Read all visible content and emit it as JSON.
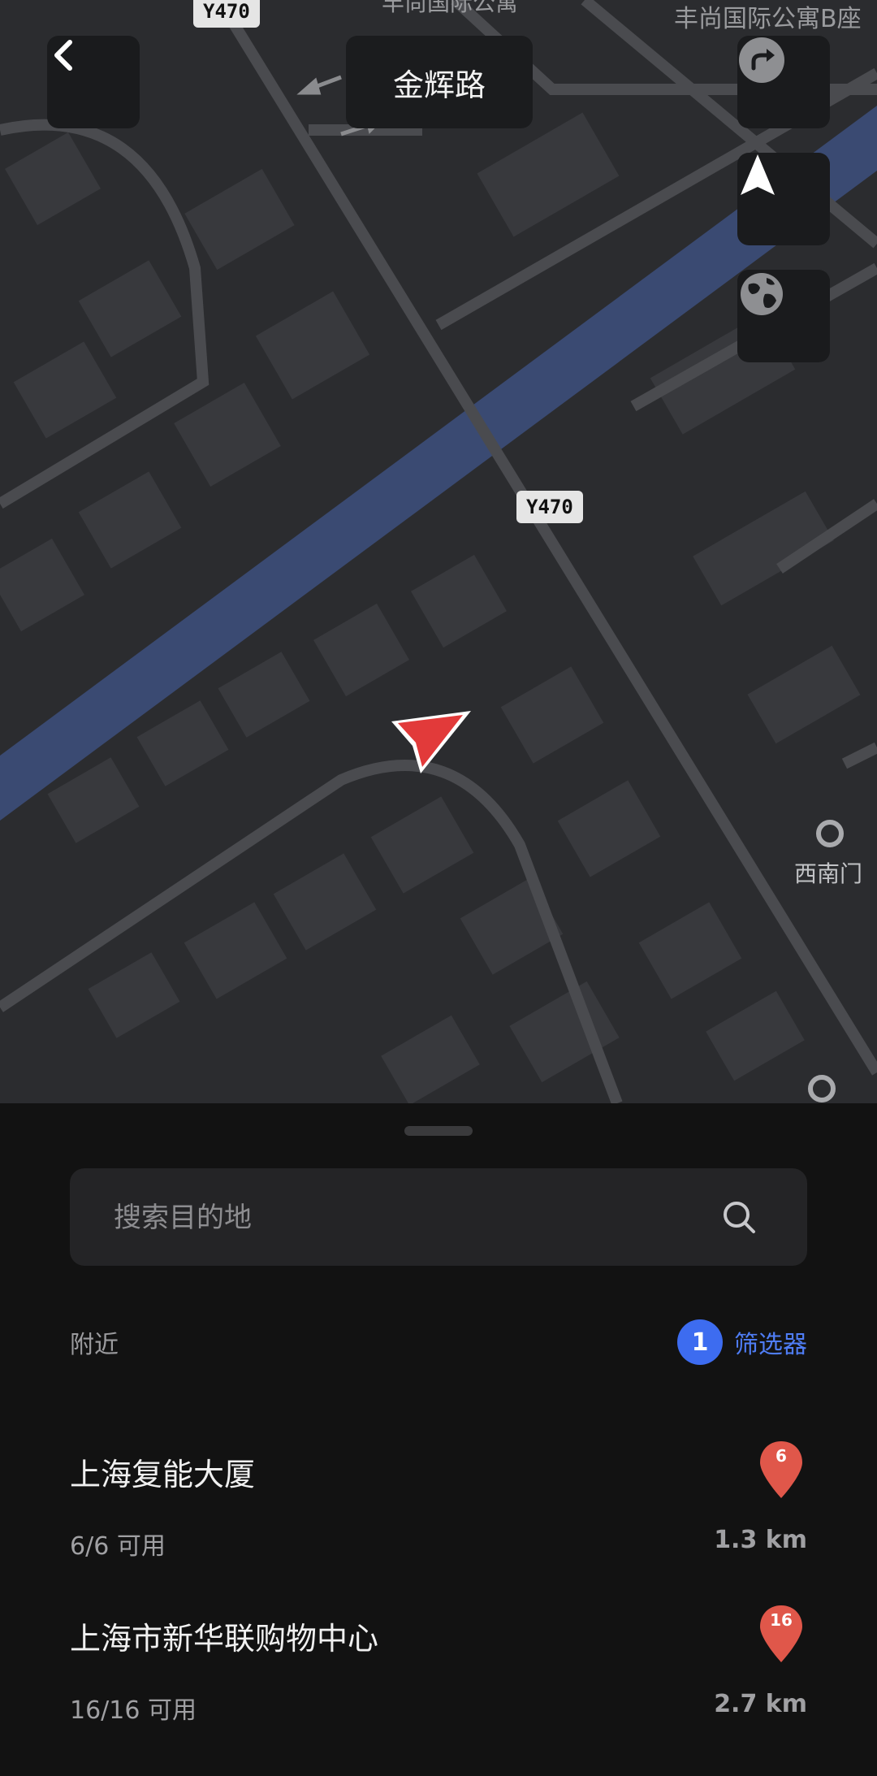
{
  "header": {
    "back_icon": "chevron-left-icon",
    "title": "金辉路",
    "share_icon": "share-arrow-icon",
    "locate_icon": "navigation-arrow-icon",
    "layer_icon": "globe-icon"
  },
  "map": {
    "road_shields": [
      "Y470",
      "Y470"
    ],
    "labels": {
      "top_center": "丰尚国际公寓",
      "top_right": "丰尚国际公寓B座",
      "poi": "西南门"
    },
    "colors": {
      "background": "#2b2c2f",
      "river": "#3a4a72",
      "road": "#4a4b4f",
      "building": "#38393d",
      "location_marker": "#e23a3a"
    }
  },
  "sheet": {
    "search": {
      "placeholder": "搜索目的地",
      "icon": "search-icon"
    },
    "nearby_label": "附近",
    "filter": {
      "count": "1",
      "label": "筛选器",
      "color": "#3d6cf0"
    },
    "places": [
      {
        "name": "上海复能大厦",
        "availability": "6/6 可用",
        "distance": "1.3 km",
        "pin_count": "6"
      },
      {
        "name": "上海市新华联购物中心",
        "availability": "16/16 可用",
        "distance": "2.7 km",
        "pin_count": "16"
      }
    ],
    "pin_color": "#e0574a"
  }
}
